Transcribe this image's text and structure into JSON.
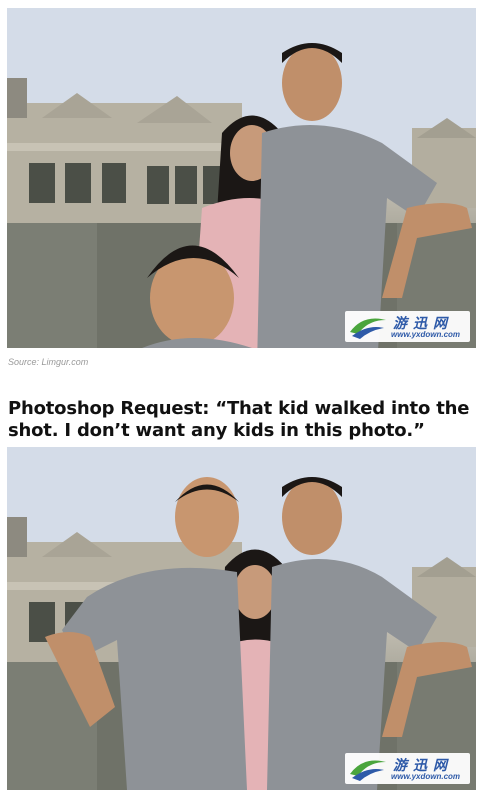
{
  "source_credit": "Source: Limgur.com",
  "headline": "Photoshop Request: “That kid walked into the shot. I don’t want any kids in this photo.”",
  "watermark": {
    "chinese": "游迅网",
    "url": "www.yxdown.com"
  },
  "colors": {
    "sky": "#d3dbe7",
    "building": "#b3ae9f",
    "stone": "#6f7268",
    "shirt": "#8e9297",
    "pink_top": "#e4b3b6",
    "skin": "#c4946f",
    "hair": "#1b1715",
    "watermark_blue": "#2e5aa8",
    "watermark_green": "#4aa53d"
  }
}
